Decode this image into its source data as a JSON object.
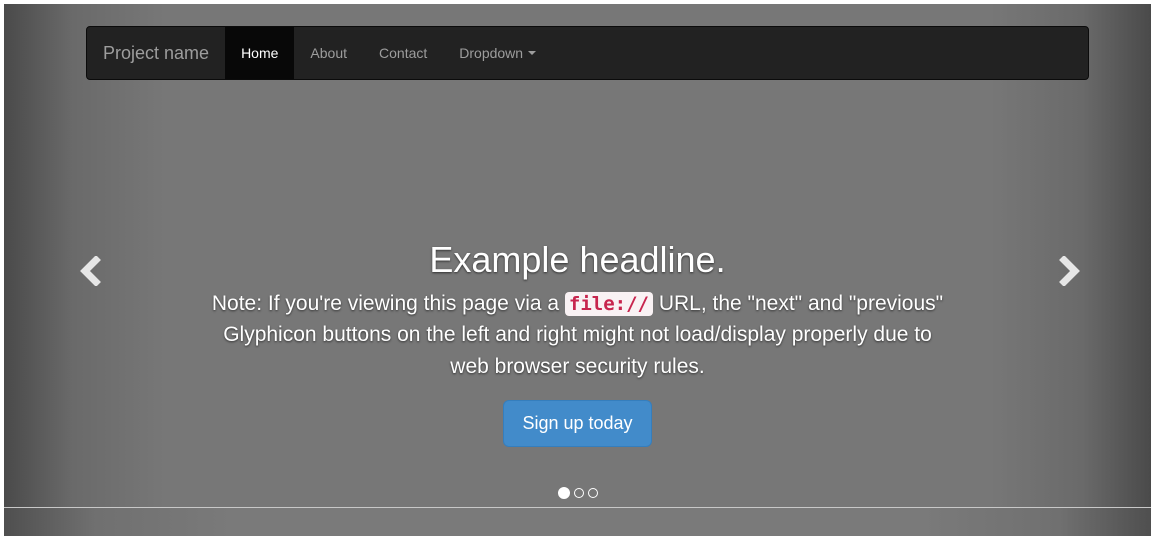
{
  "navbar": {
    "brand": "Project name",
    "items": [
      {
        "label": "Home",
        "active": true
      },
      {
        "label": "About",
        "active": false
      },
      {
        "label": "Contact",
        "active": false
      },
      {
        "label": "Dropdown",
        "active": false,
        "has_caret": true
      }
    ]
  },
  "carousel": {
    "headline": "Example headline.",
    "note_before_code": "Note: If you're viewing this page via a ",
    "note_code": "file://",
    "note_after_code": " URL, the \"next\" and \"previous\" Glyphicon buttons on the left and right might not load/display properly due to web browser security rules.",
    "button_label": "Sign up today",
    "prev_icon": "chevron-left-icon",
    "next_icon": "chevron-right-icon",
    "slide_count": 3,
    "active_slide": 1
  },
  "colors": {
    "navbar_bg": "#222222",
    "accent_button": "#428bca",
    "code_text": "#c7254e"
  }
}
